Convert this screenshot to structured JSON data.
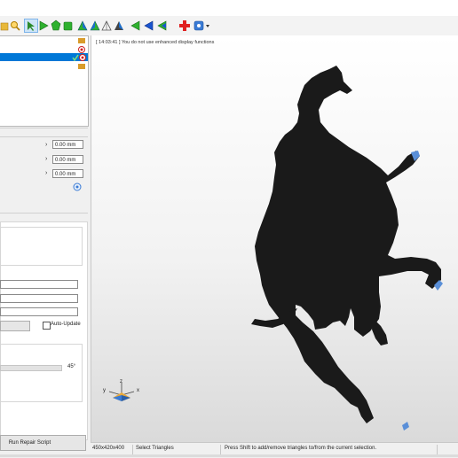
{
  "toolbar": {
    "icons": [
      "folder-icon",
      "search-icon",
      "select-pointer-icon",
      "triangle-select-icon",
      "polygon-select-icon",
      "cube-select-icon",
      "view-front-icon",
      "view-back-icon",
      "view-wireframe-icon",
      "view-edge-icon",
      "arrow-left-icon",
      "arrow-blue-icon",
      "arrow-green-icon",
      "add-red-cross-icon",
      "help-gear-icon"
    ]
  },
  "left_panel": {
    "tree_items": [
      "",
      "",
      ""
    ],
    "position_fields": [
      {
        "value": "0.00 mm"
      },
      {
        "value": "0.00 mm"
      },
      {
        "value": "0.00 mm"
      }
    ],
    "auto_update_label": "Auto-Update",
    "angle_value": "45°",
    "run_repair_label": "Run Repair Script"
  },
  "viewport": {
    "log_message": "[ 14:03:41 ] You do not use enhanced display functions",
    "axis_labels": {
      "x": "x",
      "y": "y",
      "z": "z"
    }
  },
  "status_bar": {
    "dimensions": "450x420x400",
    "mode": "Select Triangles",
    "hint": "Press Shift to add/remove triangles to/from the current selection."
  },
  "colors": {
    "selection_blue": "#0078d7",
    "model": "#1a1a1a"
  }
}
